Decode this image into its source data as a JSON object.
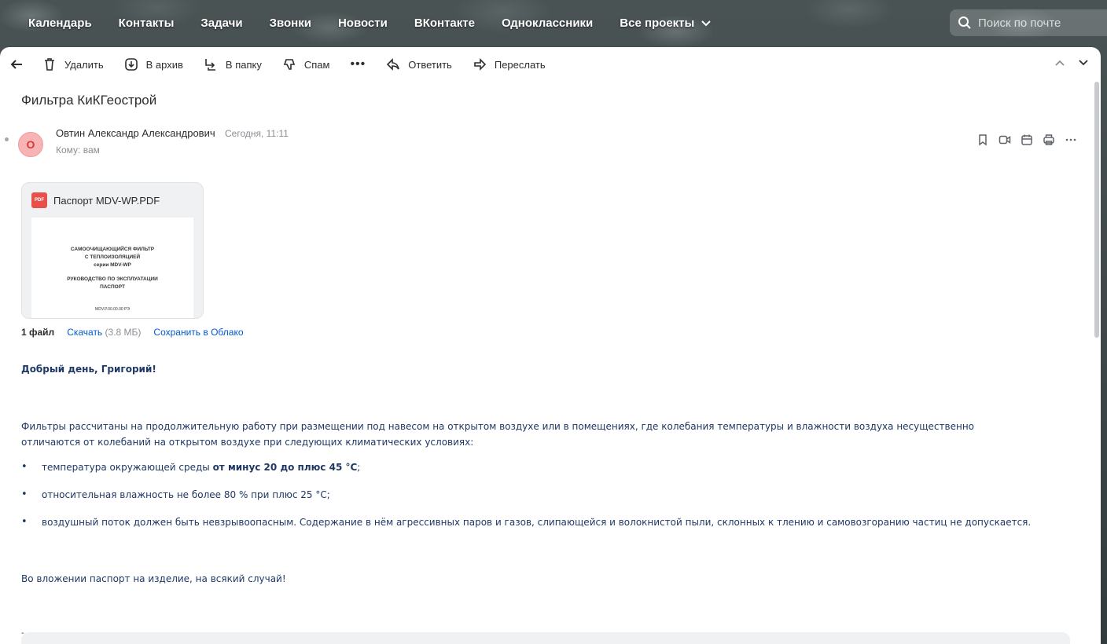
{
  "topnav": {
    "items": [
      "Календарь",
      "Контакты",
      "Задачи",
      "Звонки",
      "Новости",
      "ВКонтакте",
      "Одноклассники",
      "Все проекты"
    ],
    "search_placeholder": "Поиск по почте"
  },
  "toolbar": {
    "delete": "Удалить",
    "archive": "В архив",
    "to_folder": "В папку",
    "spam": "Спам",
    "more": "•••",
    "reply": "Ответить",
    "forward": "Переслать"
  },
  "message": {
    "subject": "Фильтра КиКГеострой",
    "avatar_letter": "О",
    "sender": "Овтин Александр Александрович",
    "date": "Сегодня, 11:11",
    "to_label": "Кому:",
    "to_value": "вам"
  },
  "attachment": {
    "filename": "Паспорт MDV-WP.PDF",
    "badge": "PDF",
    "preview_lines": [
      "САМООЧИЩАЮЩИЙСЯ ФИЛЬТР",
      "С ТЕПЛОИЗОЛЯЦИЕЙ",
      "серии MDV-WP",
      "РУКОВОДСТВО ПО ЭКСПЛУАТАЦИИ",
      "ПАСПОРТ",
      "MDV.P.00.00.00 РЭ"
    ],
    "files_count": "1 файл",
    "download": "Скачать",
    "size": "(3.8 МБ)",
    "save_cloud": "Сохранить в Облако"
  },
  "body": {
    "greeting": "Добрый день, Григорий!",
    "paragraph1": "Фильтры рассчитаны на продолжительную работу при размещении под навесом на открытом воздухе или в помещениях, где колебания температуры и влажности воздуха несущественно отличаются от колебаний на открытом воздухе при следующих климатических условиях:",
    "bullet1_pre": "температура окружающей среды ",
    "bullet1_bold": "от минус 20 до плюс 45 °С",
    "bullet1_post": ";",
    "bullet2": "относительная влажность не более 80 % при плюс 25 °С;",
    "bullet3": "воздушный поток должен быть невзрывоопасным. Содержание в нём агрессивных паров и газов, слипающейся и волокнистой пыли, склонных к тлению и самовозгоранию частиц не допускается.",
    "paragraph2": "Во вложении паспорт на изделие, на всякий случай!",
    "dash": "-"
  },
  "colors": {
    "body_text": "#1f3864",
    "link": "#005bd1",
    "avatar_bg": "#f8b4b4",
    "pdf_badge": "#e8504a"
  },
  "icons": [
    "search-icon",
    "chevron-down-icon",
    "back-arrow-icon",
    "trash-icon",
    "archive-icon",
    "folder-move-icon",
    "spam-icon",
    "reply-icon",
    "forward-icon",
    "chevron-up-icon",
    "bookmark-icon",
    "video-icon",
    "calendar-icon",
    "print-icon",
    "more-icon"
  ]
}
